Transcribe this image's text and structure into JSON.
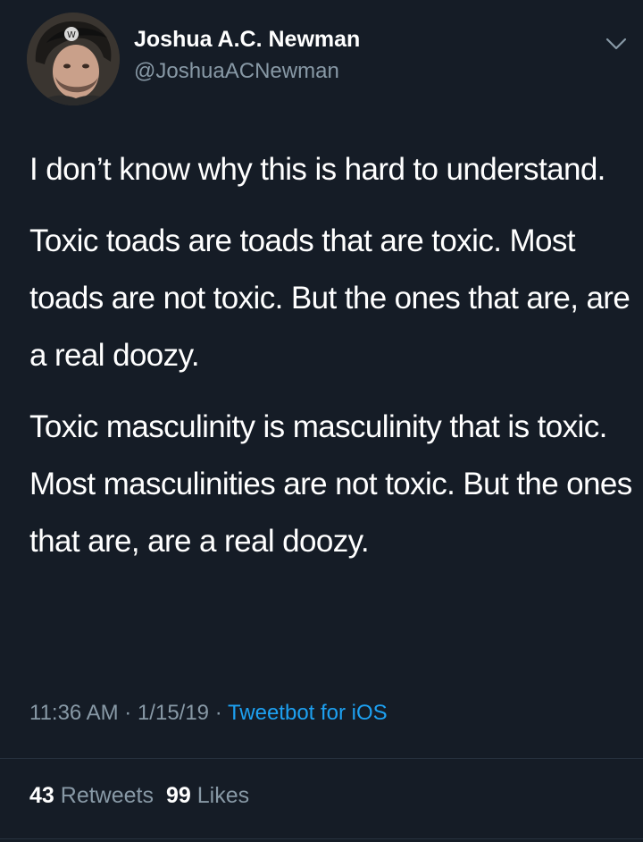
{
  "author": {
    "name": "Joshua A.C. Newman",
    "handle": "@JoshuaACNewman",
    "avatar": "avatar-image"
  },
  "menu": {
    "icon": "chevron-down-icon"
  },
  "tweet": {
    "paragraphs": [
      "I don’t know why this is hard to understand.",
      "Toxic toads are toads that are toxic. Most toads are not toxic. But the ones that are, are a real doozy.",
      "Toxic masculinity is masculinity that is toxic. Most masculinities are not toxic. But the ones that are, are a real doozy."
    ]
  },
  "meta": {
    "time": "11:36 AM",
    "separator": " · ",
    "date": "1/15/19",
    "source": "Tweetbot for iOS",
    "source_color": "#1da1f2"
  },
  "stats": {
    "retweets_count": "43",
    "retweets_label": "Retweets",
    "likes_count": "99",
    "likes_label": "Likes"
  },
  "colors": {
    "background": "#151c26",
    "text": "#ffffff",
    "secondary": "#8899a6",
    "link": "#1da1f2"
  }
}
